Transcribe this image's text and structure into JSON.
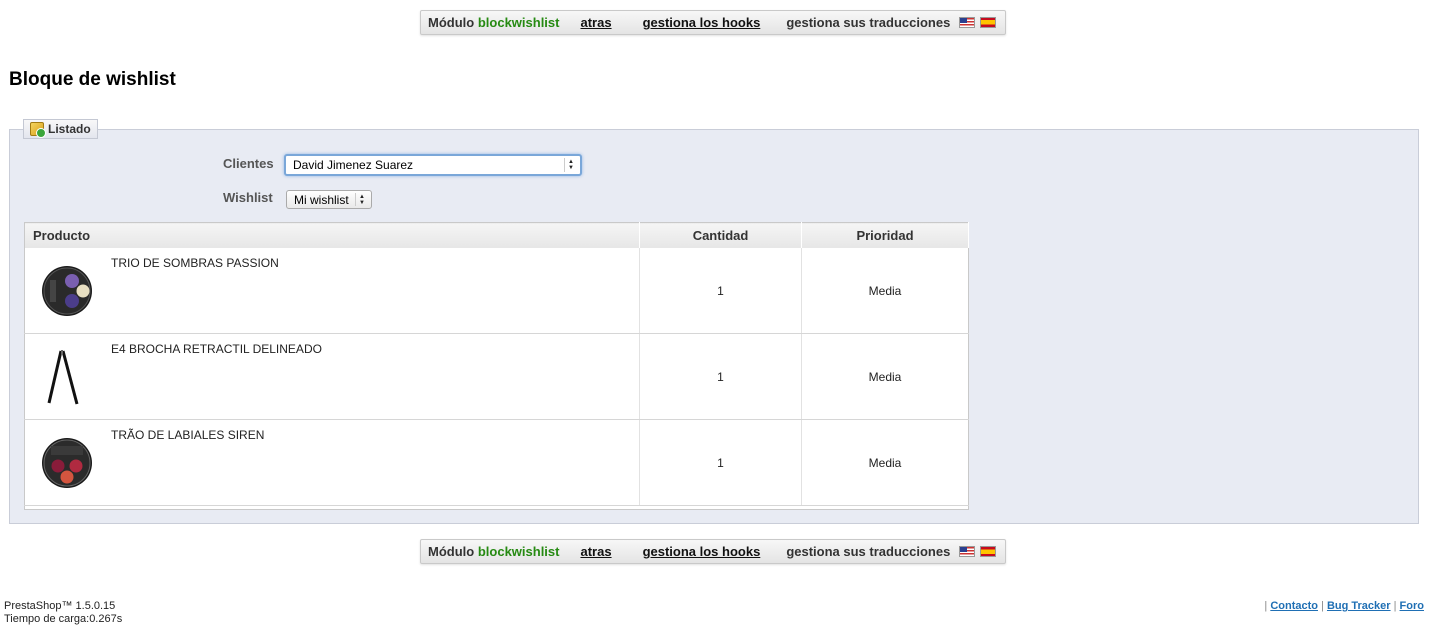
{
  "module_bar": {
    "prefix": "Módulo",
    "module_name": "blockwishlist",
    "back_link": "atras",
    "hooks_link": "gestiona los hooks",
    "translations_label": "gestiona sus traducciones",
    "flags": [
      "us-flag-icon",
      "es-flag-icon"
    ]
  },
  "page_title": "Bloque de wishlist",
  "fieldset": {
    "legend": "Listado",
    "legend_icon": "module-icon",
    "customer_label": "Clientes",
    "customer_value": "David Jimenez Suarez",
    "wishlist_label": "Wishlist",
    "wishlist_value": "Mi wishlist"
  },
  "table": {
    "headers": [
      "Producto",
      "Cantidad",
      "Prioridad"
    ],
    "rows": [
      {
        "name": "TRIO DE SOMBRAS PASSION",
        "quantity": "1",
        "priority": "Media",
        "image": "eyeshadow-trio-icon"
      },
      {
        "name": "E4 BROCHA RETRACTIL DELINEADO",
        "quantity": "1",
        "priority": "Media",
        "image": "brush-icon"
      },
      {
        "name": "TRÃO DE LABIALES SIREN",
        "quantity": "1",
        "priority": "Media",
        "image": "lip-trio-icon"
      }
    ]
  },
  "footer": {
    "version": "PrestaShop™ 1.5.0.15",
    "load_time": "Tiempo de carga:0.267s",
    "links": [
      "Contacto",
      "Bug Tracker",
      "Foro"
    ],
    "separator": "|"
  },
  "colors": {
    "module_name": "#268a12",
    "panel_bg": "#e8ebf3",
    "link": "#1f6fb4"
  }
}
